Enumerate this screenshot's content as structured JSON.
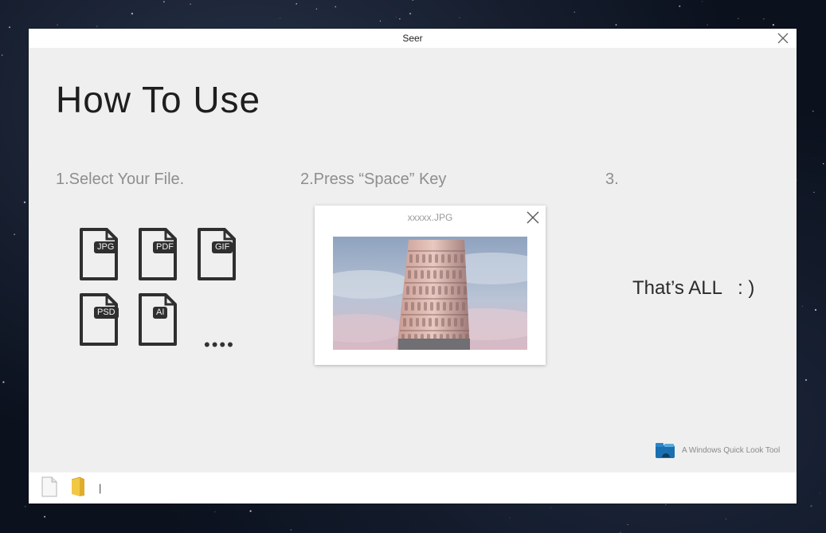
{
  "window": {
    "title": "Seer"
  },
  "main": {
    "heading": "How To Use",
    "steps": [
      {
        "label": "1.Select Your File."
      },
      {
        "label": "2.Press “Space” Key"
      },
      {
        "label": "3."
      }
    ],
    "file_types": [
      "JPG",
      "PDF",
      "GIF",
      "PSD",
      "AI"
    ],
    "more_indicator": "••••",
    "preview": {
      "filename": "xxxxx.JPG"
    },
    "closing_text": "That’s ALL   : )"
  },
  "brand": {
    "tagline": "A Windows Quick Look Tool",
    "accent": "#1a6fb0"
  },
  "bottom_bar": {
    "path_text": "|"
  },
  "icons": {
    "close": "close-icon",
    "file": "file-icon",
    "folder": "folder-icon",
    "logo": "seer-logo-icon"
  }
}
